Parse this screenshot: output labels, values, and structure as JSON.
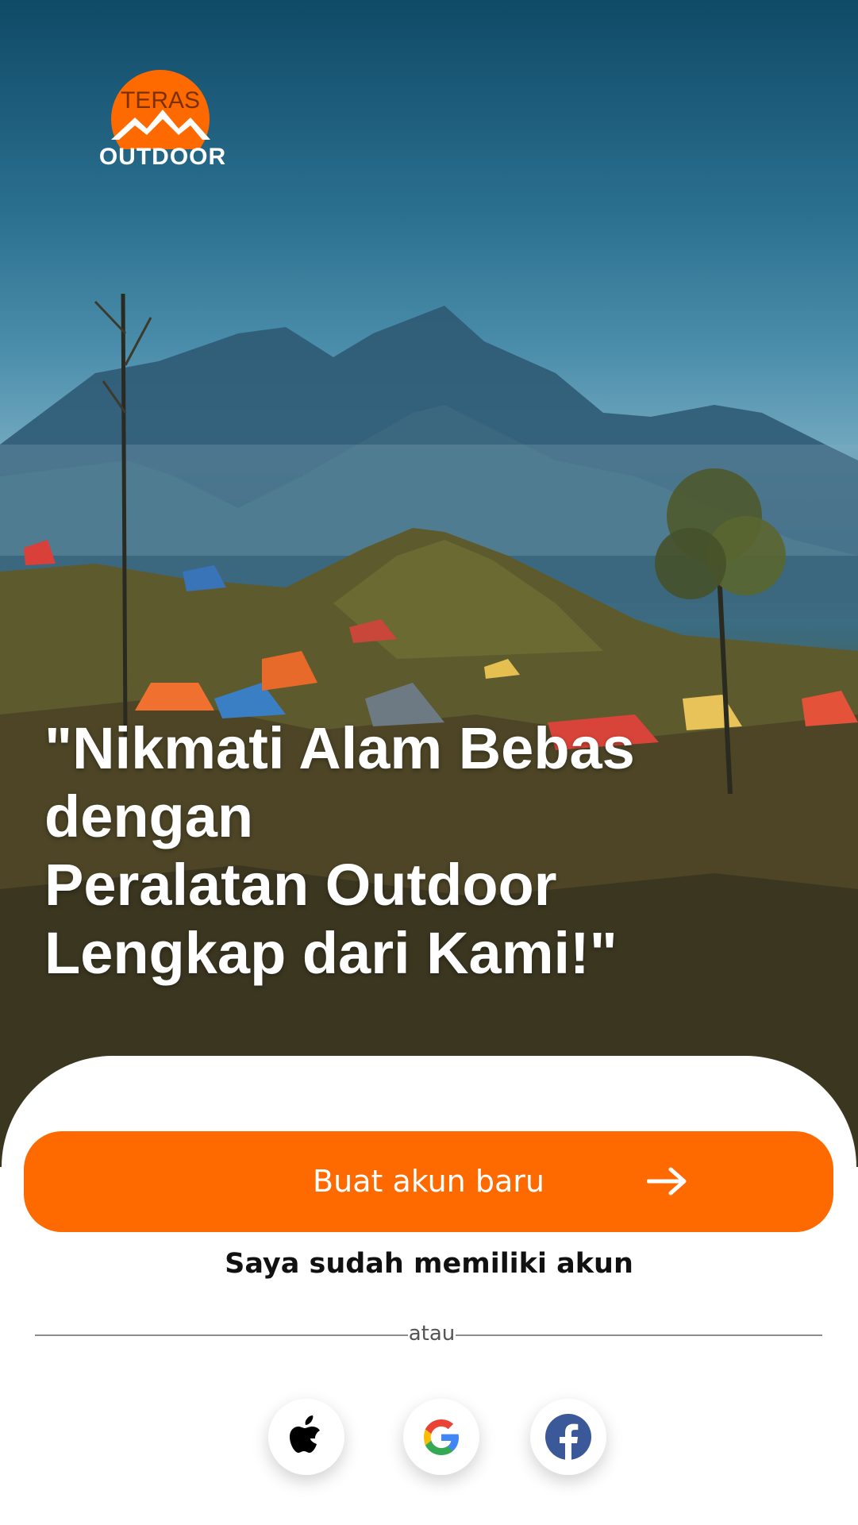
{
  "brand": {
    "logo_top_text": "TERAS",
    "logo_bottom_text": "OUTDOOR",
    "accent_color": "#ff6a00"
  },
  "hero": {
    "tagline": "\"Nikmati Alam Bebas dengan\nPeralatan Outdoor\nLengkap dari Kami!\""
  },
  "actions": {
    "create_account_label": "Buat akun baru",
    "create_account_icon": "arrow-right-icon",
    "login_label": "Saya sudah memiliki akun"
  },
  "divider": {
    "label": "atau"
  },
  "social_logins": [
    {
      "provider": "apple",
      "icon": "apple-icon"
    },
    {
      "provider": "google",
      "icon": "google-icon"
    },
    {
      "provider": "facebook",
      "icon": "facebook-icon"
    }
  ]
}
